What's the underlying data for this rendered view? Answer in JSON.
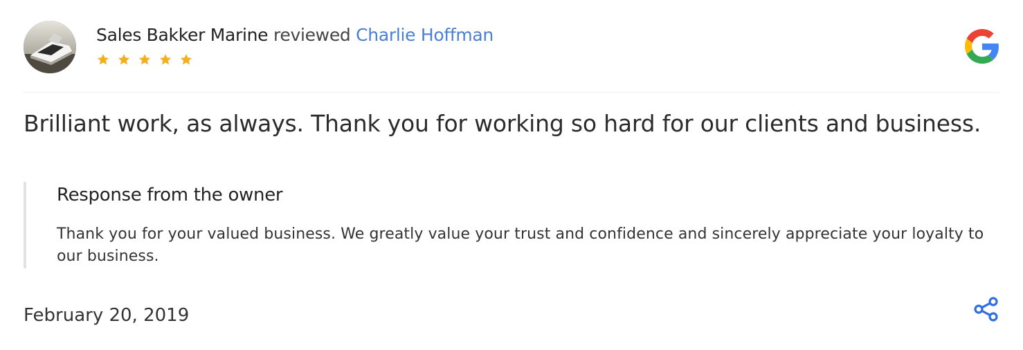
{
  "review": {
    "reviewer_name": "Sales Bakker Marine",
    "reviewed_word": "reviewed",
    "reviewed_target": "Charlie Hoffman",
    "rating": 5,
    "rating_max": 5,
    "text": "Brilliant work, as always. Thank you for working so hard for our clients and business.",
    "date": "February 20, 2019"
  },
  "owner_response": {
    "title": "Response from the owner",
    "text": "Thank you for your valued business. We greatly value your trust and confidence and sincerely appreciate your loyalty to our business."
  },
  "icons": {
    "source": "google-icon",
    "share": "share-icon",
    "star": "star-icon",
    "avatar": "boat-avatar"
  },
  "colors": {
    "link": "#4a7fd1",
    "star": "#f2b01e",
    "share": "#2f6fe0",
    "border": "#e2e2e2"
  }
}
